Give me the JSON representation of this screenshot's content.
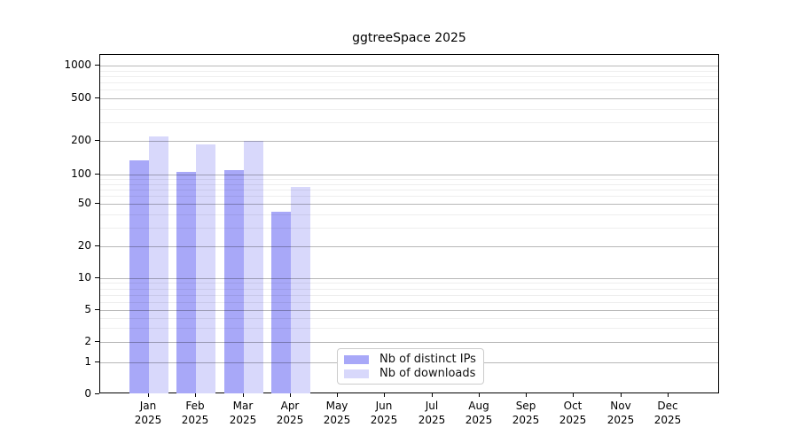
{
  "title": "ggtreeSpace 2025",
  "chart_data": {
    "type": "bar",
    "title": "ggtreeSpace 2025",
    "categories": [
      "Jan",
      "Feb",
      "Mar",
      "Apr",
      "May",
      "Jun",
      "Jul",
      "Aug",
      "Sep",
      "Oct",
      "Nov",
      "Dec"
    ],
    "category_sublabel": "2025",
    "series": [
      {
        "name": "Nb of distinct IPs",
        "color": "#a8a8f8",
        "values": [
          135,
          105,
          110,
          42,
          0,
          0,
          0,
          0,
          0,
          0,
          0,
          0
        ]
      },
      {
        "name": "Nb of downloads",
        "color": "#d8d8fb",
        "values": [
          220,
          185,
          200,
          75,
          0,
          0,
          0,
          0,
          0,
          0,
          0,
          0
        ]
      }
    ],
    "xlabel": "",
    "ylabel": "",
    "y_scale": "symlog",
    "y_ticks": [
      0,
      1,
      2,
      5,
      10,
      20,
      50,
      100,
      200,
      500,
      1000
    ],
    "y_minor_ticks": [
      3,
      4,
      6,
      7,
      8,
      9,
      30,
      40,
      60,
      70,
      80,
      90,
      300,
      400,
      600,
      700,
      800,
      900
    ],
    "ylim": [
      0,
      1400
    ],
    "grid": true,
    "legend_position": "lower-center-inside"
  }
}
